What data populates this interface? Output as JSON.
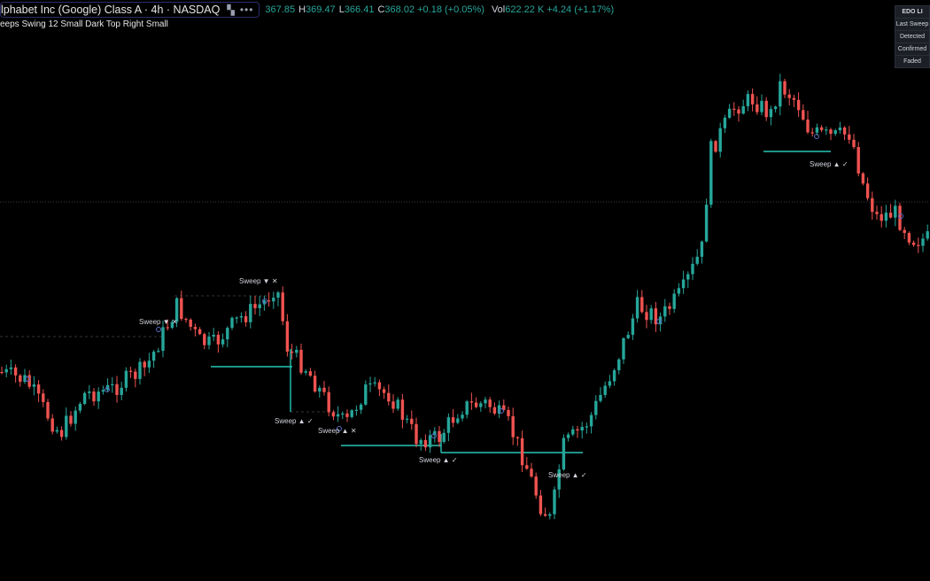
{
  "header": {
    "symbol_title": "lphabet Inc (Google) Class A · 4h · NASDAQ",
    "more_icon": "more-dots-icon",
    "ohlc": {
      "o_label": "",
      "o_value": "367.85",
      "h_label": "H",
      "h_value": "369.47",
      "l_label": "L",
      "l_value": "366.41",
      "c_label": "C",
      "c_value": "368.02 +0.18 (+0.05%)",
      "vol_label": "Vol",
      "vol_value": "622.22 K +4.24 (+1.17%)"
    },
    "up_color": "#26a69a",
    "down_color": "#ef5350"
  },
  "indicator": {
    "label": "eeps Swing 12 Small Dark Top Right Small"
  },
  "legend": {
    "title": "EDO LI",
    "rows": [
      "Last Sweep",
      "Detected",
      "Confirmed",
      "Faded"
    ]
  },
  "tags": [
    {
      "text": "Sweep ▼ ✕",
      "kind": "dn"
    },
    {
      "text": "Sweep ▼ ✕",
      "kind": "dn"
    },
    {
      "text": "Sweep ▲ ✓",
      "kind": "up"
    },
    {
      "text": "Sweep ▲ ✕",
      "kind": "dn"
    },
    {
      "text": "Sweep ▲ ✓",
      "kind": "up"
    },
    {
      "text": "Sweep ▲ ✓",
      "kind": "up"
    },
    {
      "text": "Sweep ▲ ✓",
      "kind": "up"
    }
  ]
}
